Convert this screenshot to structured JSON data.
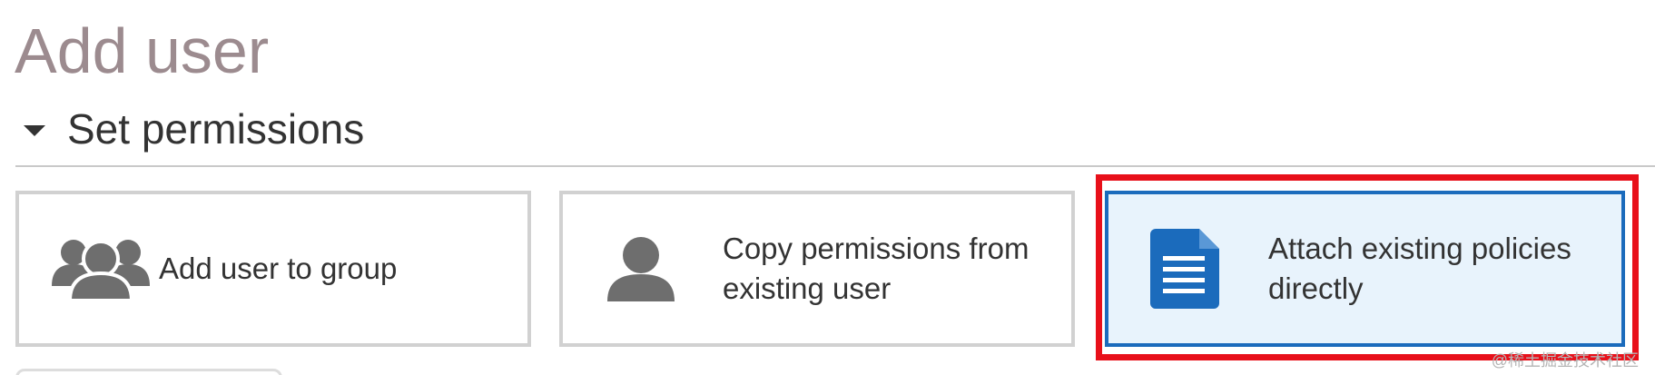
{
  "page": {
    "title": "Add user"
  },
  "section": {
    "title": "Set permissions",
    "expanded": true
  },
  "options": {
    "group": {
      "label": "Add user to group",
      "icon": "user-group-icon",
      "selected": false
    },
    "copy": {
      "line1": "Copy permissions from",
      "line2": "existing user",
      "icon": "user-icon",
      "selected": false
    },
    "attach": {
      "line1": "Attach existing policies",
      "line2": "directly",
      "icon": "document-icon",
      "selected": true
    }
  },
  "watermark": "@稀土掘金技术社区",
  "colors": {
    "title": "#9c8b8f",
    "text": "#333333",
    "border": "#d1d1d1",
    "selected_border": "#1b6bbc",
    "selected_bg": "#e8f3fc",
    "icon_gray": "#6e6e6e",
    "icon_blue": "#1b6bbc",
    "highlight": "#e8101a"
  }
}
